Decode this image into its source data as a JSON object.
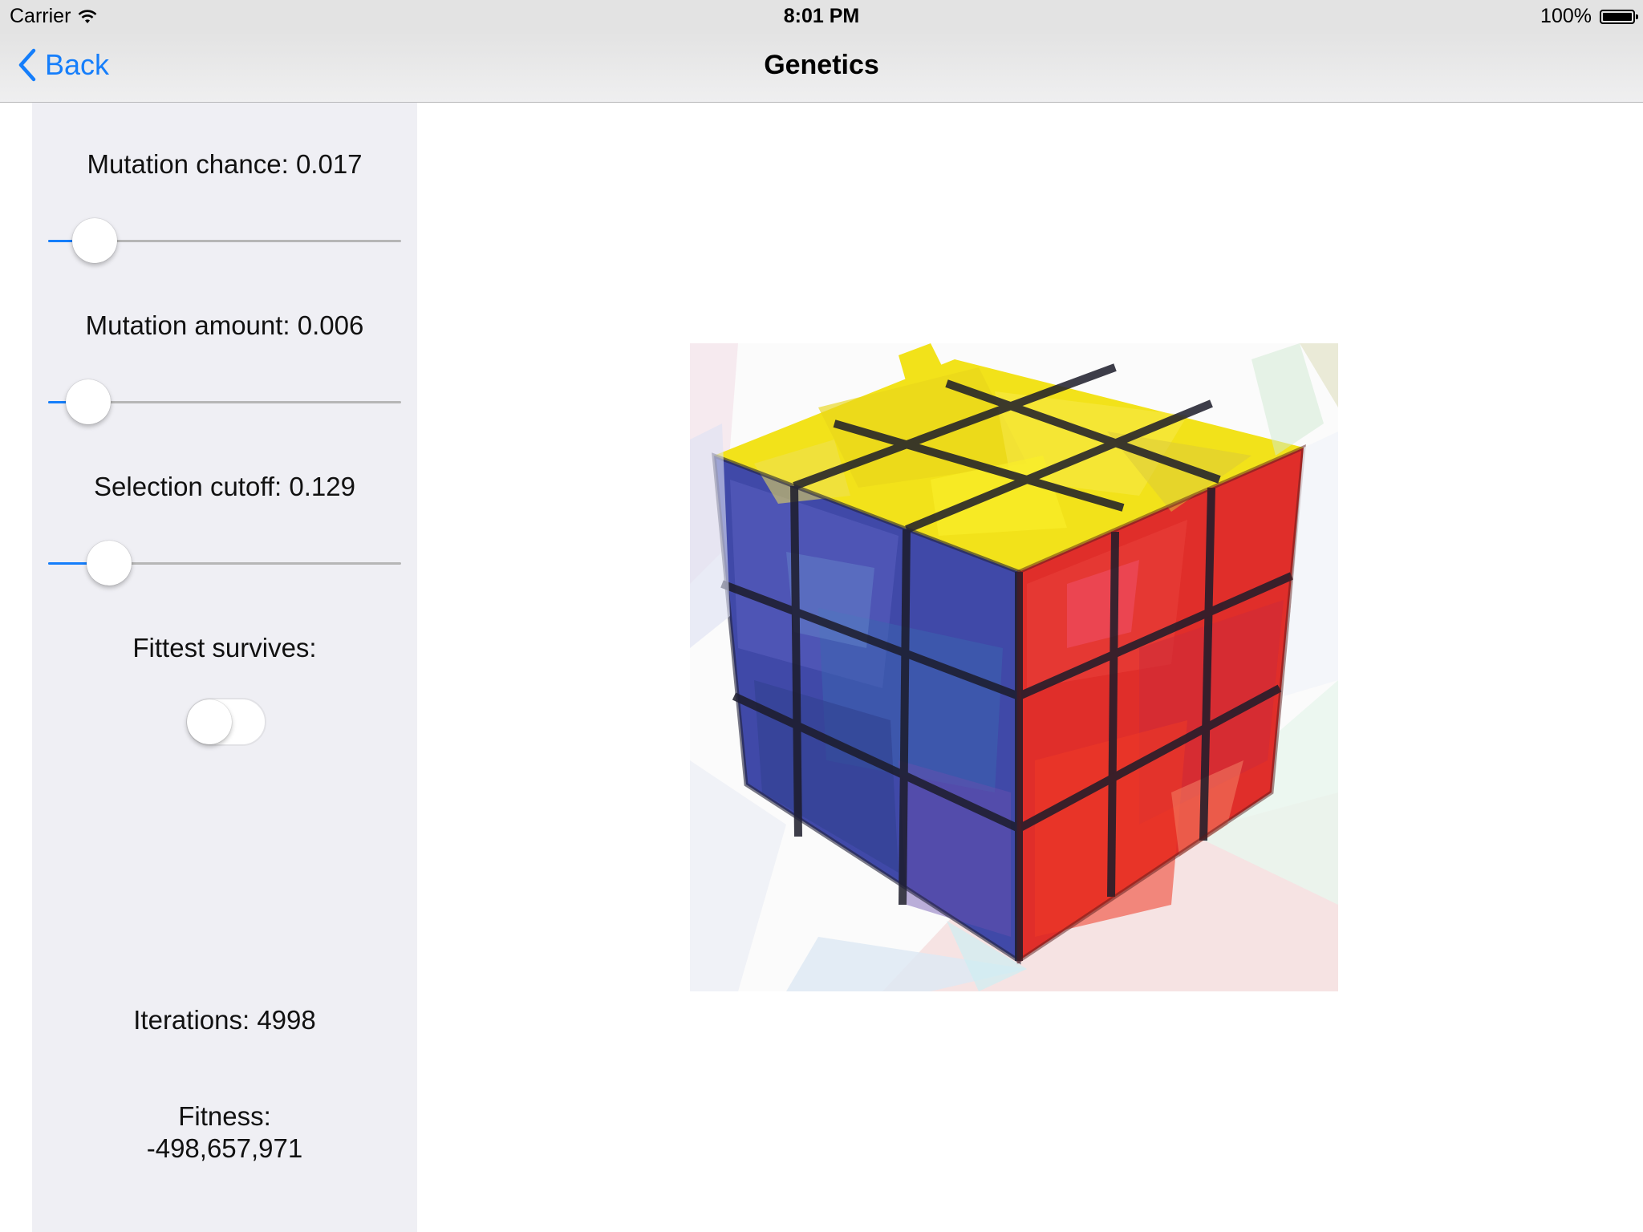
{
  "status_bar": {
    "carrier": "Carrier",
    "time": "8:01 PM",
    "battery": "100%"
  },
  "nav": {
    "back_label": "Back",
    "title": "Genetics",
    "accent_color": "#157efb"
  },
  "controls": {
    "mutation_chance": {
      "label": "Mutation chance: 0.017",
      "value": 0.017
    },
    "mutation_amount": {
      "label": "Mutation amount: 0.006",
      "value": 0.006
    },
    "selection_cutoff": {
      "label": "Selection cutoff: 0.129",
      "value": 0.129
    },
    "fittest_survives": {
      "label": "Fittest survives:",
      "on": false
    }
  },
  "stats": {
    "iterations": "Iterations: 4998",
    "fitness_label": "Fitness:",
    "fitness_value": "-498,657,971"
  },
  "image": {
    "subject": "rubiks-cube-polygon-approximation",
    "face_colors": {
      "top": "#f2e21a",
      "left": "#4049a8",
      "right": "#e02e2a",
      "grid": "#1c1c2a"
    }
  }
}
